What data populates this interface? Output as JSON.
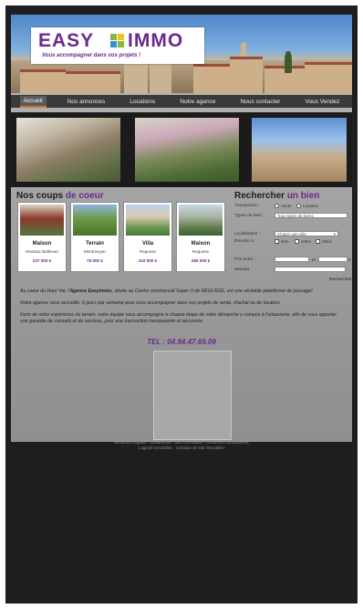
{
  "brand": {
    "name_part1": "EASY",
    "name_part2": "IMMO",
    "tagline": "Vous accompagner dans vos projets !",
    "colors": {
      "purple": "#6b2a8e",
      "green": "#86b83a",
      "yellow": "#f0c419",
      "blue": "#3a8fd0"
    }
  },
  "nav": {
    "items": [
      {
        "label": "Accueil",
        "active": true
      },
      {
        "label": "Nos annonces",
        "active": false
      },
      {
        "label": "Locations",
        "active": false
      },
      {
        "label": "Notre agence",
        "active": false
      },
      {
        "label": "Nous contacter",
        "active": false
      },
      {
        "label": "Vous Vendez",
        "active": false
      }
    ]
  },
  "coups": {
    "title_part1": "Nos coups",
    "title_part2": "de coeur",
    "cards": [
      {
        "type": "Maison",
        "town": "Moissac Bellevue",
        "price": "237 000 €"
      },
      {
        "type": "Terrain",
        "town": "Montmeyan",
        "price": "75 000 €"
      },
      {
        "type": "Villa",
        "town": "Regusse",
        "price": "410 000 €"
      },
      {
        "type": "Maison",
        "town": "Regusse",
        "price": "285 000 €"
      }
    ]
  },
  "search": {
    "title_part1": "Rechercher",
    "title_part2": "un bien",
    "transaction_label": "Transaction :",
    "transaction_opt1": "Vente",
    "transaction_opt2": "Location",
    "types_label": "Types de bien :",
    "types_value": "Tous types de biens",
    "localisation_label": "Localisation :",
    "localisation_value": "Choisir une ville",
    "etendre_label": "Etendre à :",
    "radius_opts": [
      "5km",
      "10km",
      "20km"
    ],
    "prix_label": "Prix entre :",
    "prix_et": "et",
    "prix_unit": "€",
    "mandat_label": "Mandat :",
    "submit_label": "Rechercher"
  },
  "content": {
    "para1_a": "Au coeur du Haut Var, l'",
    "para1_b": "Agence Easyimmo",
    "para1_c": ", située au Centre commercial Super U de REGUSSE, est une véritable plateforme de passage!",
    "para2": "Notre agence vous accueille, 6 jours par semaine pour vous accompagner dans vos projets de vente, d'achat ou de location.",
    "para3": "Forts de notre expérience du terrain, notre équipe vous accompagne à chaque étape de votre démarche y compris à l'urbanisme, afin de vous apporter une garantie de conseils et de services, pour une transaction transparente et sécurisée.",
    "tel": "TEL : 04.94.47.69.09"
  },
  "footer": {
    "line1": "Mentions Légales · Lexiteimmo · Nos honoraires · Annonces Immobilières",
    "line2": "Logiciel immobilier · Création de site immobilier"
  }
}
